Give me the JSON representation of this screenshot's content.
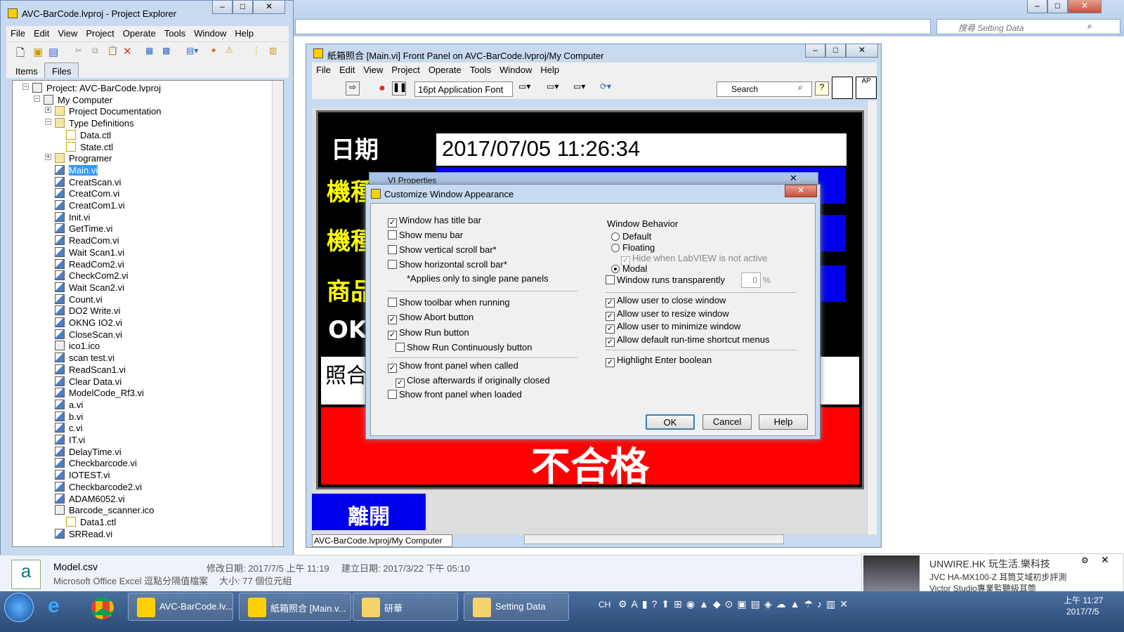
{
  "background_window": {
    "search_placeholder": "搜尋 Setting Data"
  },
  "project_explorer": {
    "title": "AVC-BarCode.lvproj - Project Explorer",
    "menu": [
      "File",
      "Edit",
      "View",
      "Project",
      "Operate",
      "Tools",
      "Window",
      "Help"
    ],
    "tabs": [
      "Items",
      "Files"
    ],
    "tree": [
      {
        "label": "Project: AVC-BarCode.lvproj",
        "type": "proj"
      },
      {
        "label": "My Computer",
        "type": "pc"
      },
      {
        "label": "Project Documentation",
        "type": "fld"
      },
      {
        "label": "Type Definitions",
        "type": "fld"
      },
      {
        "label": "Data.ctl",
        "type": "ctl"
      },
      {
        "label": "State.ctl",
        "type": "ctl"
      },
      {
        "label": "Programer",
        "type": "fld"
      },
      {
        "label": "Main.vi",
        "type": "vi",
        "selected": true
      },
      {
        "label": "CreatScan.vi",
        "type": "vi"
      },
      {
        "label": "CreatCom.vi",
        "type": "vi"
      },
      {
        "label": "CreatCom1.vi",
        "type": "vi"
      },
      {
        "label": "Init.vi",
        "type": "vi"
      },
      {
        "label": "GetTime.vi",
        "type": "vi"
      },
      {
        "label": "ReadCom.vi",
        "type": "vi"
      },
      {
        "label": "Wait Scan1.vi",
        "type": "vi"
      },
      {
        "label": "ReadCom2.vi",
        "type": "vi"
      },
      {
        "label": "CheckCom2.vi",
        "type": "vi"
      },
      {
        "label": "Wait Scan2.vi",
        "type": "vi"
      },
      {
        "label": "Count.vi",
        "type": "vi"
      },
      {
        "label": "DO2 Write.vi",
        "type": "vi"
      },
      {
        "label": "OKNG IO2.vi",
        "type": "vi"
      },
      {
        "label": "CloseScan.vi",
        "type": "vi"
      },
      {
        "label": "ico1.ico",
        "type": "ico"
      },
      {
        "label": "scan test.vi",
        "type": "vi"
      },
      {
        "label": "ReadScan1.vi",
        "type": "vi"
      },
      {
        "label": "Clear Data.vi",
        "type": "vi"
      },
      {
        "label": "ModelCode_Rf3.vi",
        "type": "vi"
      },
      {
        "label": "a.vi",
        "type": "vi"
      },
      {
        "label": "b.vi",
        "type": "vi"
      },
      {
        "label": "c.vi",
        "type": "vi"
      },
      {
        "label": "IT.vi",
        "type": "vi"
      },
      {
        "label": "DelayTime.vi",
        "type": "vi"
      },
      {
        "label": "Checkbarcode.vi",
        "type": "vi"
      },
      {
        "label": "IOTEST.vi",
        "type": "vi"
      },
      {
        "label": "Checkbarcode2.vi",
        "type": "vi"
      },
      {
        "label": "ADAM6052.vi",
        "type": "vi"
      },
      {
        "label": "Barcode_scanner.ico",
        "type": "ico"
      },
      {
        "label": "Data1.ctl",
        "type": "ctl"
      },
      {
        "label": "SRRead.vi",
        "type": "vi"
      }
    ]
  },
  "front_panel": {
    "title": "紙箱照合 [Main.vi] Front Panel on AVC-BarCode.lvproj/My Computer",
    "menu": [
      "File",
      "Edit",
      "View",
      "Project",
      "Operate",
      "Tools",
      "Window",
      "Help"
    ],
    "font": "16pt Application Font",
    "search": "Search",
    "labels": {
      "date": "日期",
      "model1": "機種",
      "model2": "機種",
      "product": "商品",
      "ok": "OK"
    },
    "datetime": "2017/07/05 11:26:34",
    "compare_text": "照合",
    "result_text": "不合格",
    "exit_button": "離開",
    "status_path": "AVC-BarCode.lvproj/My Computer"
  },
  "vi_properties": {
    "title": "VI Properties"
  },
  "dialog": {
    "title": "Customize Window Appearance",
    "left_options": [
      {
        "label": "Window has title bar",
        "checked": true
      },
      {
        "label": "Show menu bar",
        "checked": false
      },
      {
        "label": "Show vertical scroll bar*",
        "checked": false
      },
      {
        "label": "Show horizontal scroll bar*",
        "checked": false
      }
    ],
    "note": "*Applies only to single pane panels",
    "left_options2": [
      {
        "label": "Show toolbar when running",
        "checked": false
      },
      {
        "label": "Show Abort button",
        "checked": true
      },
      {
        "label": "Show Run button",
        "checked": true
      },
      {
        "label": "Show Run Continuously button",
        "checked": false,
        "indent": true
      }
    ],
    "left_options3": [
      {
        "label": "Show front panel when called",
        "checked": true
      },
      {
        "label": "Close afterwards if originally closed",
        "checked": true,
        "indent": true
      },
      {
        "label": "Show front panel when loaded",
        "checked": false
      }
    ],
    "behavior_title": "Window Behavior",
    "behavior_options": [
      {
        "label": "Default",
        "selected": false
      },
      {
        "label": "Floating",
        "selected": false
      },
      {
        "label": "Modal",
        "selected": true
      }
    ],
    "hide_when_inactive": "Hide when LabVIEW is not active",
    "transparent_label": "Window runs transparently",
    "transparent_value": "0",
    "transparent_unit": "%",
    "right_options": [
      {
        "label": "Allow user to close window",
        "checked": true
      },
      {
        "label": "Allow user to resize window",
        "checked": true
      },
      {
        "label": "Allow user to minimize window",
        "checked": true
      },
      {
        "label": "Allow default run-time shortcut menus",
        "checked": true
      }
    ],
    "highlight_label": "Highlight Enter boolean",
    "buttons": {
      "ok": "OK",
      "cancel": "Cancel",
      "help": "Help"
    }
  },
  "file_info": {
    "name": "Model.csv",
    "type": "Microsoft Office Excel 逗點分隔值檔案",
    "modified": "修改日期: 2017/7/5 上午 11:19",
    "size": "大小: 77 個位元組",
    "created": "建立日期: 2017/3/22 下午 05:10"
  },
  "notification": {
    "source": "UNWIRE.HK 玩生活.樂科技",
    "line1": "JVC HA-MX100-Z 耳筒艾域初步評測",
    "line2": "Victor Studio專業監聽級耳筒"
  },
  "taskbar": {
    "buttons": [
      "AVC-BarCode.lv...",
      "紙箱照合 [Main.v...",
      "研華",
      "Setting Data"
    ],
    "lang": "CH",
    "time": "上午 11:27",
    "date": "2017/7/5"
  }
}
